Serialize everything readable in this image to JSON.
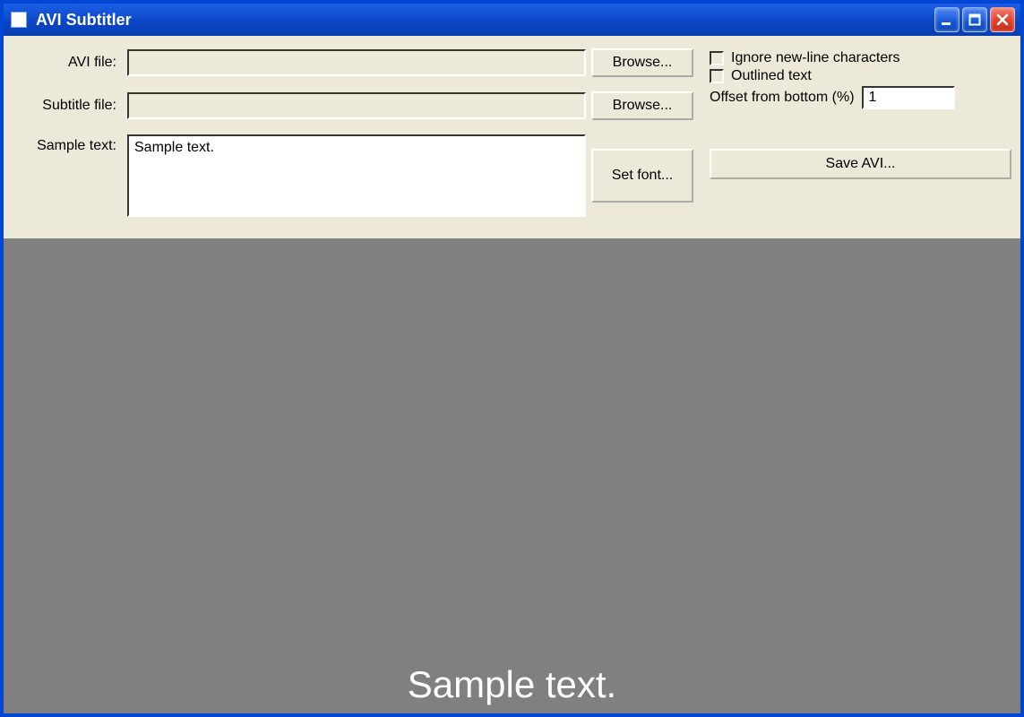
{
  "window": {
    "title": "AVI Subtitler"
  },
  "labels": {
    "avi_file": "AVI file:",
    "subtitle_file": "Subtitle file:",
    "sample_text": "Sample text:"
  },
  "fields": {
    "avi_file_value": "",
    "subtitle_file_value": "",
    "sample_text_value": "Sample text."
  },
  "buttons": {
    "browse_avi": "Browse...",
    "browse_subtitle": "Browse...",
    "set_font": "Set font...",
    "save_avi": "Save AVI..."
  },
  "options": {
    "ignore_newlines_label": "Ignore new-line characters",
    "outlined_text_label": "Outlined text",
    "offset_label": "Offset from bottom (%)",
    "offset_value": "1",
    "ignore_newlines_checked": false,
    "outlined_text_checked": false
  },
  "preview": {
    "text": "Sample text."
  }
}
